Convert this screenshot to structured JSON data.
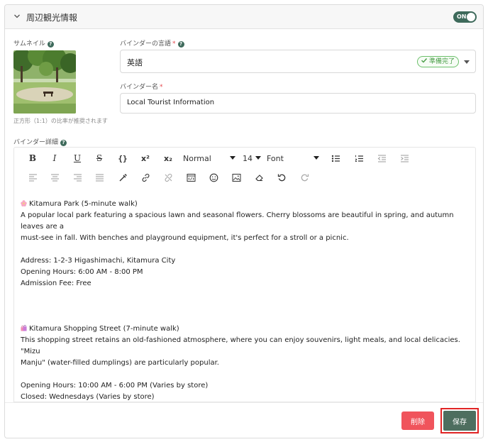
{
  "section": {
    "title": "周辺観光情報",
    "toggle_label": "ON"
  },
  "thumbnail": {
    "label": "サムネイル",
    "note": "正方形（1:1）の比率が推奨されます"
  },
  "language": {
    "label": "バインダーの言語",
    "value": "英語",
    "status": "準備完了"
  },
  "binder_name": {
    "label": "バインダー名",
    "value": "Local Tourist Information"
  },
  "details": {
    "label": "バインダー詳細"
  },
  "toolbar": {
    "bold": "B",
    "italic": "I",
    "underline": "U",
    "strike": "S",
    "code": "{}",
    "superscript": "x²",
    "subscript": "x₂",
    "heading": "Normal",
    "size": "14",
    "font": "Font"
  },
  "editor": {
    "lines": [
      "Kitamura Park (5-minute walk)",
      "A popular local park featuring a spacious lawn and seasonal flowers. Cherry blossoms are beautiful in spring, and autumn leaves are a",
      "must-see in fall. With benches and playground equipment, it's perfect for a stroll or a picnic.",
      "",
      "Address: 1-2-3 Higashimachi, Kitamura City",
      "Opening Hours: 6:00 AM - 8:00 PM",
      "Admission Fee: Free",
      "",
      "",
      "",
      "Kitamura Shopping Street (7-minute walk)",
      "This shopping street retains an old-fashioned atmosphere, where you can enjoy souvenirs, light meals, and local delicacies. \"Mizu",
      "Manju\" (water-filled dumplings) are particularly popular.",
      "",
      "Opening Hours: 10:00 AM - 6:00 PM (Varies by store)",
      "Closed: Wednesdays (Varies by store)",
      "",
      "",
      ","
    ]
  },
  "actions": {
    "delete_label": "削除",
    "save_label": "保存"
  },
  "colors": {
    "accent": "#3e6a5b",
    "danger": "#f0545c",
    "ready": "#4a9e48",
    "highlight": "#e02424"
  }
}
